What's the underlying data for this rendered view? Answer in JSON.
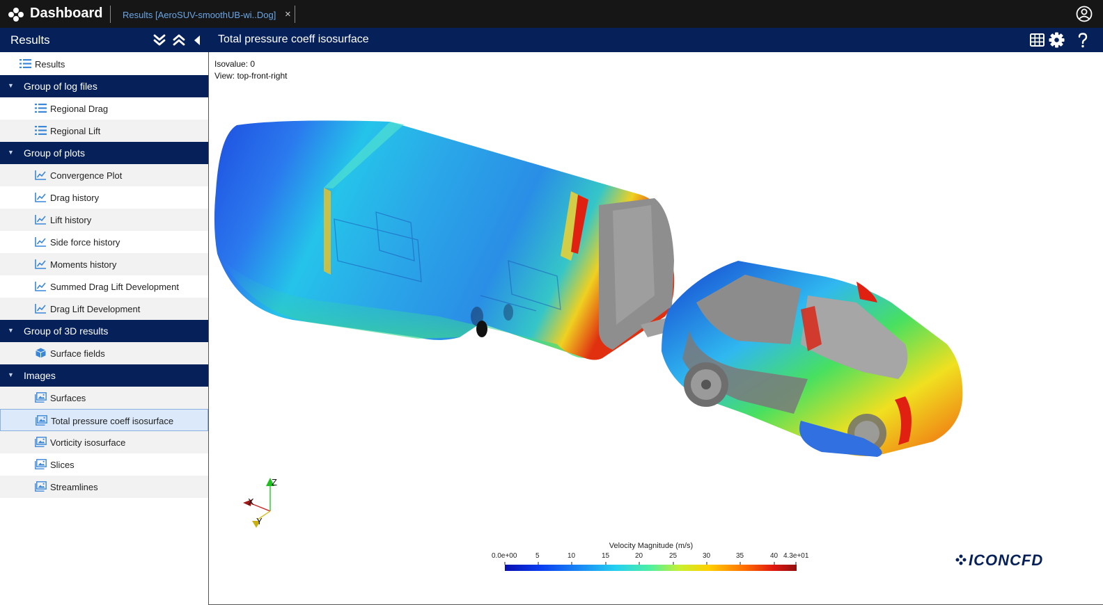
{
  "topbar": {
    "brand": "Dashboard",
    "tab_label": "Results [AeroSUV-smoothUB-wi..Dog]",
    "tab_close": "×"
  },
  "sidebar": {
    "title": "Results",
    "top_item": "Results",
    "groups": [
      {
        "label": "Group of log files",
        "items": [
          "Regional Drag",
          "Regional Lift"
        ]
      },
      {
        "label": "Group of plots",
        "items": [
          "Convergence Plot",
          "Drag history",
          "Lift history",
          "Side force history",
          "Moments history",
          "Summed Drag Lift Development",
          "Drag Lift Development"
        ]
      },
      {
        "label": "Group of 3D results",
        "items": [
          "Surface fields"
        ]
      },
      {
        "label": "Images",
        "items": [
          "Surfaces",
          "Total pressure coeff isosurface",
          "Vorticity isosurface",
          "Slices",
          "Streamlines"
        ]
      }
    ],
    "selected_item": "Total pressure coeff isosurface"
  },
  "main": {
    "title": "Total pressure coeff isosurface",
    "isovalue": "Isovalue: 0",
    "view": "View: top-front-right"
  },
  "axes": {
    "z": "Z",
    "x": "X",
    "y": "Y"
  },
  "colorbar": {
    "title": "Velocity Magnitude (m/s)",
    "ticks": [
      "0.0e+00",
      "5",
      "10",
      "15",
      "20",
      "25",
      "30",
      "35",
      "40",
      "4.3e+01"
    ],
    "range": [
      0,
      43
    ]
  },
  "footer_logo": "ICONCFD",
  "colors": {
    "topbar": "#161616",
    "navy": "#06205a",
    "accent": "#3a86d8",
    "selected_bg": "#dce9fa"
  },
  "icons": [
    "dashboard-logo-icon",
    "user-circle-icon",
    "expand-all-icon",
    "collapse-all-icon",
    "collapse-panel-icon",
    "list-icon",
    "chart-line-icon",
    "cube-icon",
    "image-icon",
    "grid-icon",
    "gear-icon",
    "help-icon"
  ]
}
